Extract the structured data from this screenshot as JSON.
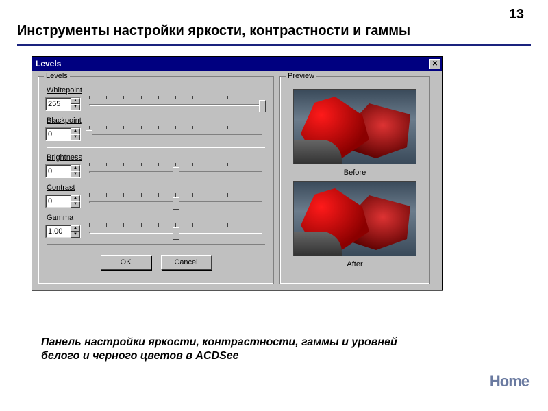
{
  "page": {
    "number": "13",
    "title": "Инструменты настройки яркости, контрастности и гаммы",
    "caption": "Панель настройки яркости, контрастности, гаммы и уровней белого и черного цветов в ACDSee",
    "home": "Home"
  },
  "dialog": {
    "title": "Levels",
    "levels_legend": "Levels",
    "preview_legend": "Preview",
    "sliders": {
      "whitepoint": {
        "label": "Whitepoint",
        "value": "255",
        "pos": 100
      },
      "blackpoint": {
        "label": "Blackpoint",
        "value": "0",
        "pos": 0
      },
      "brightness": {
        "label": "Brightness",
        "value": "0",
        "pos": 50
      },
      "contrast": {
        "label": "Contrast",
        "value": "0",
        "pos": 50
      },
      "gamma": {
        "label": "Gamma",
        "value": "1.00",
        "pos": 50
      }
    },
    "buttons": {
      "ok": "OK",
      "cancel": "Cancel"
    },
    "preview": {
      "before": "Before",
      "after": "After"
    }
  }
}
